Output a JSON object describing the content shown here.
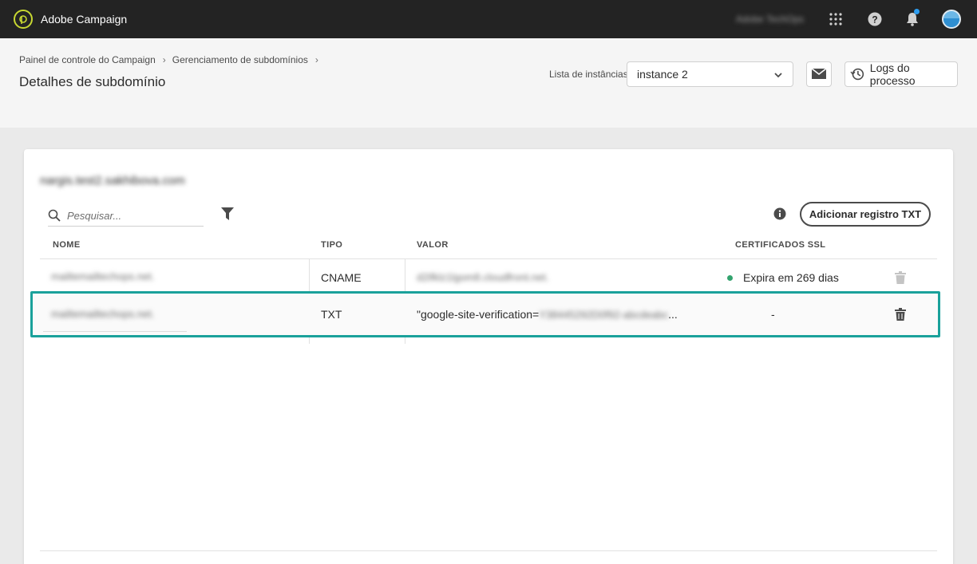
{
  "topbar": {
    "app_title": "Adobe Campaign",
    "org_name": "Adobe TechOps",
    "icons": [
      "app-logo-icon",
      "apps-grid-icon",
      "help-icon",
      "bell-icon",
      "avatar"
    ]
  },
  "header": {
    "breadcrumb": [
      "Painel de controle do Campaign",
      "Gerenciamento de subdomínios"
    ],
    "page_title": "Detalhes de subdomínio",
    "instance_label": "Lista de instâncias",
    "instance_selected": "instance 2",
    "logs_button": "Logs do processo"
  },
  "card": {
    "domain": "nargis.test2.sakhibova.com",
    "search_placeholder": "Pesquisar...",
    "add_button": "Adicionar registro TXT",
    "columns": [
      "NOME",
      "TIPO",
      "VALOR",
      "CERTIFICADOS SSL"
    ],
    "rows": [
      {
        "name": "mailtemailtechops.net.",
        "type": "CNAME",
        "value": "d2ifklz1lgom8.cloudfront.net.",
        "ssl": "Expira em 269 dias"
      },
      {
        "name": "mailtemailtechops.net.",
        "type": "TXT",
        "value_prefix": "\"google-site-verification=",
        "value_blurred": "Y38445292D0f92-abcdeabc",
        "value_suffix": "...",
        "ssl": "-"
      }
    ]
  },
  "colors": {
    "topbar": "#232323",
    "highlight": "#1aa19b",
    "status_ok": "#33a36e",
    "logo_accent": "#c8d832"
  }
}
